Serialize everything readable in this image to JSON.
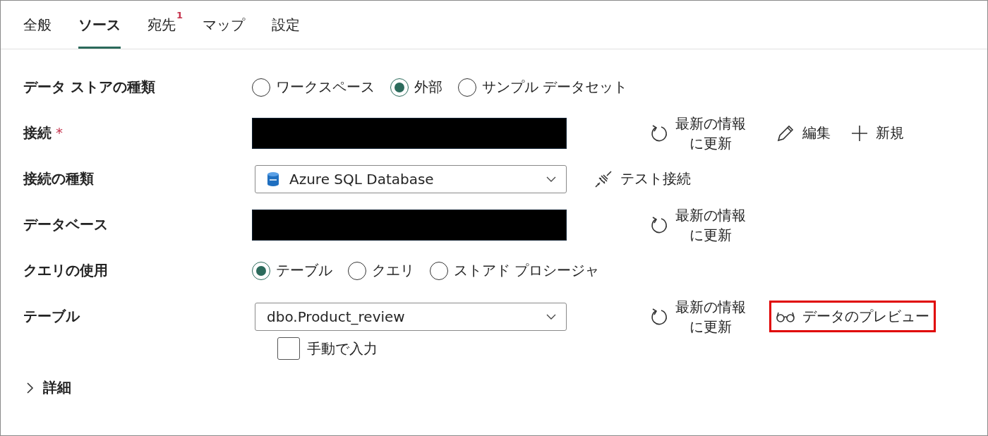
{
  "tabs": [
    {
      "label": "全般",
      "selected": false
    },
    {
      "label": "ソース",
      "selected": true
    },
    {
      "label": "宛先",
      "selected": false,
      "badge": "1"
    },
    {
      "label": "マップ",
      "selected": false
    },
    {
      "label": "設定",
      "selected": false
    }
  ],
  "form": {
    "rows": [
      {
        "label": "データ ストアの種類",
        "control": {
          "kind": "radio",
          "options": [
            {
              "label": "ワークスペース",
              "selected": false
            },
            {
              "label": "外部",
              "selected": true
            },
            {
              "label": "サンプル データセット",
              "selected": false
            }
          ]
        }
      },
      {
        "label": "接続",
        "required_mark": "*",
        "control": {
          "kind": "redacted"
        },
        "actions": [
          {
            "kind": "refresh",
            "label": "最新の情報に更新"
          },
          {
            "kind": "edit",
            "label": "編集"
          },
          {
            "kind": "new",
            "label": "新規"
          }
        ]
      },
      {
        "label": "接続の種類",
        "control": {
          "kind": "service-select",
          "value": "Azure SQL Database"
        },
        "actions": [
          {
            "kind": "test",
            "label": "テスト接続"
          }
        ]
      },
      {
        "label": "データベース",
        "control": {
          "kind": "redacted"
        },
        "actions": [
          {
            "kind": "refresh",
            "label": "最新の情報に更新"
          }
        ]
      },
      {
        "label": "クエリの使用",
        "control": {
          "kind": "radio",
          "options": [
            {
              "label": "テーブル",
              "selected": true
            },
            {
              "label": "クエリ",
              "selected": false
            },
            {
              "label": "ストアド プロシージャ",
              "selected": false
            }
          ]
        }
      },
      {
        "label": "テーブル",
        "control": {
          "kind": "select",
          "value": "dbo.Product_review"
        },
        "actions": [
          {
            "kind": "refresh",
            "label": "最新の情報に更新"
          },
          {
            "kind": "preview",
            "label": "データのプレビュー",
            "highlighted": true
          }
        ],
        "checkbox": {
          "label": "手動で入力",
          "checked": false
        }
      }
    ]
  },
  "expander": {
    "label": "詳細",
    "expanded": false
  }
}
